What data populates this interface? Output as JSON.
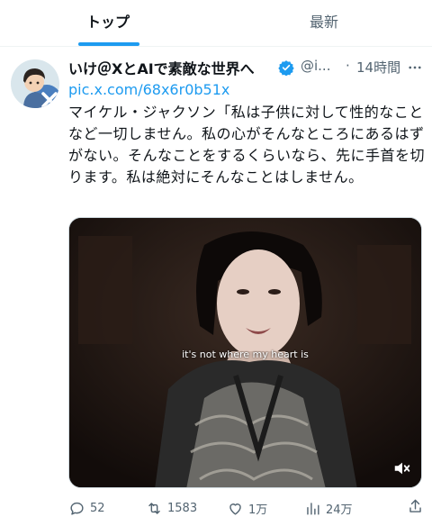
{
  "tabs": [
    {
      "label": "トップ",
      "active": true
    },
    {
      "label": "最新",
      "active": false
    }
  ],
  "tweet": {
    "display_name": "いけ＠XとAIで素敵な世界へ",
    "handle": "@i...",
    "separator": "·",
    "time": "14時間",
    "link": "pic.x.com/68x6r0b51x",
    "text": "マイケル・ジャクソン「私は子供に対して性的なことなど一切しません。私の心がそんなところにあるはずがない。そんなことをするくらいなら、先に手首を切ります。私は絶対にそんなことはしません。",
    "media": {
      "subtitle": "it's not where my heart is",
      "muted": true
    },
    "stats": {
      "replies": "52",
      "reposts": "1583",
      "likes": "1万",
      "views": "24万"
    }
  },
  "colors": {
    "accent": "#1d9bf0",
    "text": "#0f1419",
    "secondary": "#536471",
    "verified": "#1d9bf0"
  }
}
